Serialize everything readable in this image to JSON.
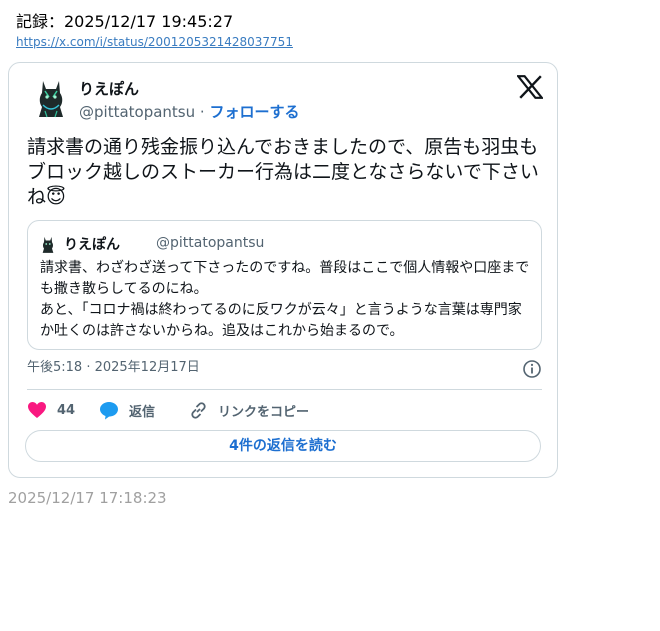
{
  "record": {
    "label": "記録：2025/12/17 19:45:27",
    "link": "https://x.com/i/status/2001205321428037751"
  },
  "tweet": {
    "author_name": "りえぽん",
    "handle": "@pittatopantsu",
    "separator": " · ",
    "follow_label": "フォローする",
    "text": "請求書の通り残金振り込んでおきましたので、原告も羽虫もブロック越しのストーカー行為は二度となさらないで下さいね😇",
    "timestamp": "午後5:18 · 2025年12月17日",
    "likes": "44",
    "reply_label": "返信",
    "copy_link_label": "リンクをコピー",
    "read_replies_label": "4件の返信を読む"
  },
  "quote": {
    "author_name": "りえぽん",
    "handle": "@pittatopantsu",
    "text": "請求書、わざわざ送って下さったのですね。普段はここで個人情報や口座までも撒き散らしてるのにね。\nあと、「コロナ禍は終わってるのに反ワクが云々」と言うような言葉は専門家か吐くのは許さないからね。追及はこれから始まるので。"
  },
  "footer": {
    "time": "2025/12/17 17:18:23"
  },
  "colors": {
    "accent": "#1d6fd0",
    "like": "#f91880",
    "reply": "#1d9bf0",
    "muted": "#536471",
    "border": "#cfd9de"
  },
  "icons": [
    "cat-avatar",
    "x-logo-icon",
    "info-icon",
    "heart-icon",
    "reply-bubble-icon",
    "link-icon"
  ]
}
